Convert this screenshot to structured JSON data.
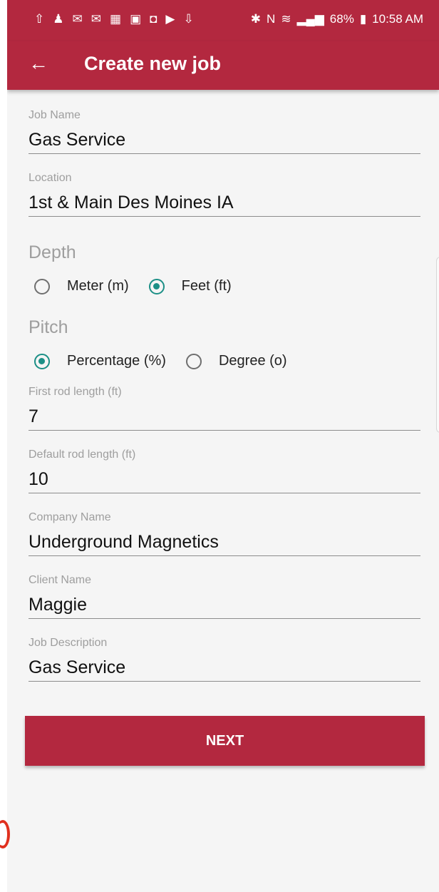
{
  "status_bar": {
    "icons_left": [
      "upload-icon",
      "person-icon",
      "mail-icon",
      "mail-alt-icon",
      "calendar-icon",
      "gallery-icon",
      "lock-icon",
      "youtube-icon",
      "download-icon"
    ],
    "icons_right": [
      "bluetooth-icon",
      "nfc-icon",
      "wifi-icon",
      "lte-icon",
      "signal-icon",
      "battery-icon"
    ],
    "battery": "68%",
    "time": "10:58 AM"
  },
  "app_bar": {
    "title": "Create new job"
  },
  "form": {
    "job_name": {
      "label": "Job Name",
      "value": "Gas Service"
    },
    "location": {
      "label": "Location",
      "value": "1st & Main Des Moines IA"
    },
    "depth": {
      "title": "Depth",
      "options": [
        {
          "label": "Meter (m)",
          "selected": false
        },
        {
          "label": "Feet (ft)",
          "selected": true
        }
      ]
    },
    "pitch": {
      "title": "Pitch",
      "options": [
        {
          "label": "Percentage (%)",
          "selected": true
        },
        {
          "label": "Degree (o)",
          "selected": false
        }
      ]
    },
    "first_rod": {
      "label": "First rod length (ft)",
      "value": "7"
    },
    "default_rod": {
      "label": "Default rod length (ft)",
      "value": "10"
    },
    "company": {
      "label": "Company Name",
      "value": "Underground Magnetics"
    },
    "client": {
      "label": "Client Name",
      "value": "Maggie"
    },
    "description": {
      "label": "Job Description",
      "value": "Gas Service"
    }
  },
  "next_label": "NEXT",
  "colors": {
    "primary": "#b3283f",
    "accent": "#1c8f86"
  }
}
